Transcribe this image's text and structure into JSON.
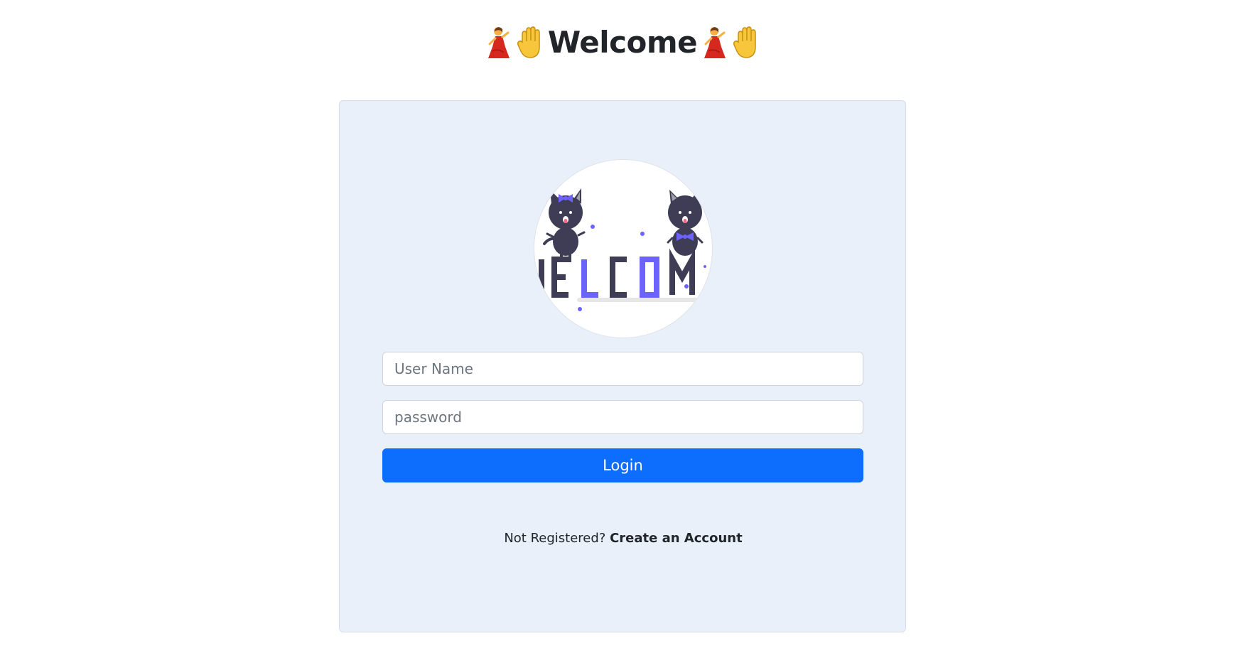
{
  "header": {
    "title": "Welcome",
    "leading_icons": [
      "dancer-icon",
      "raised-hand-icon"
    ],
    "trailing_icons": [
      "dancer-icon",
      "raised-hand-icon"
    ]
  },
  "login_form": {
    "avatar_image_text": "ELCOM",
    "username_placeholder": "User Name",
    "username_value": "",
    "password_placeholder": "password",
    "password_value": "",
    "login_label": "Login",
    "register_prompt": "Not Registered?",
    "register_link": "Create an Account"
  },
  "colors": {
    "card_background": "#e9f0f9",
    "primary": "#0d6efd",
    "illustration_accent": "#6c63ff",
    "illustration_dark": "#3f3d56"
  }
}
